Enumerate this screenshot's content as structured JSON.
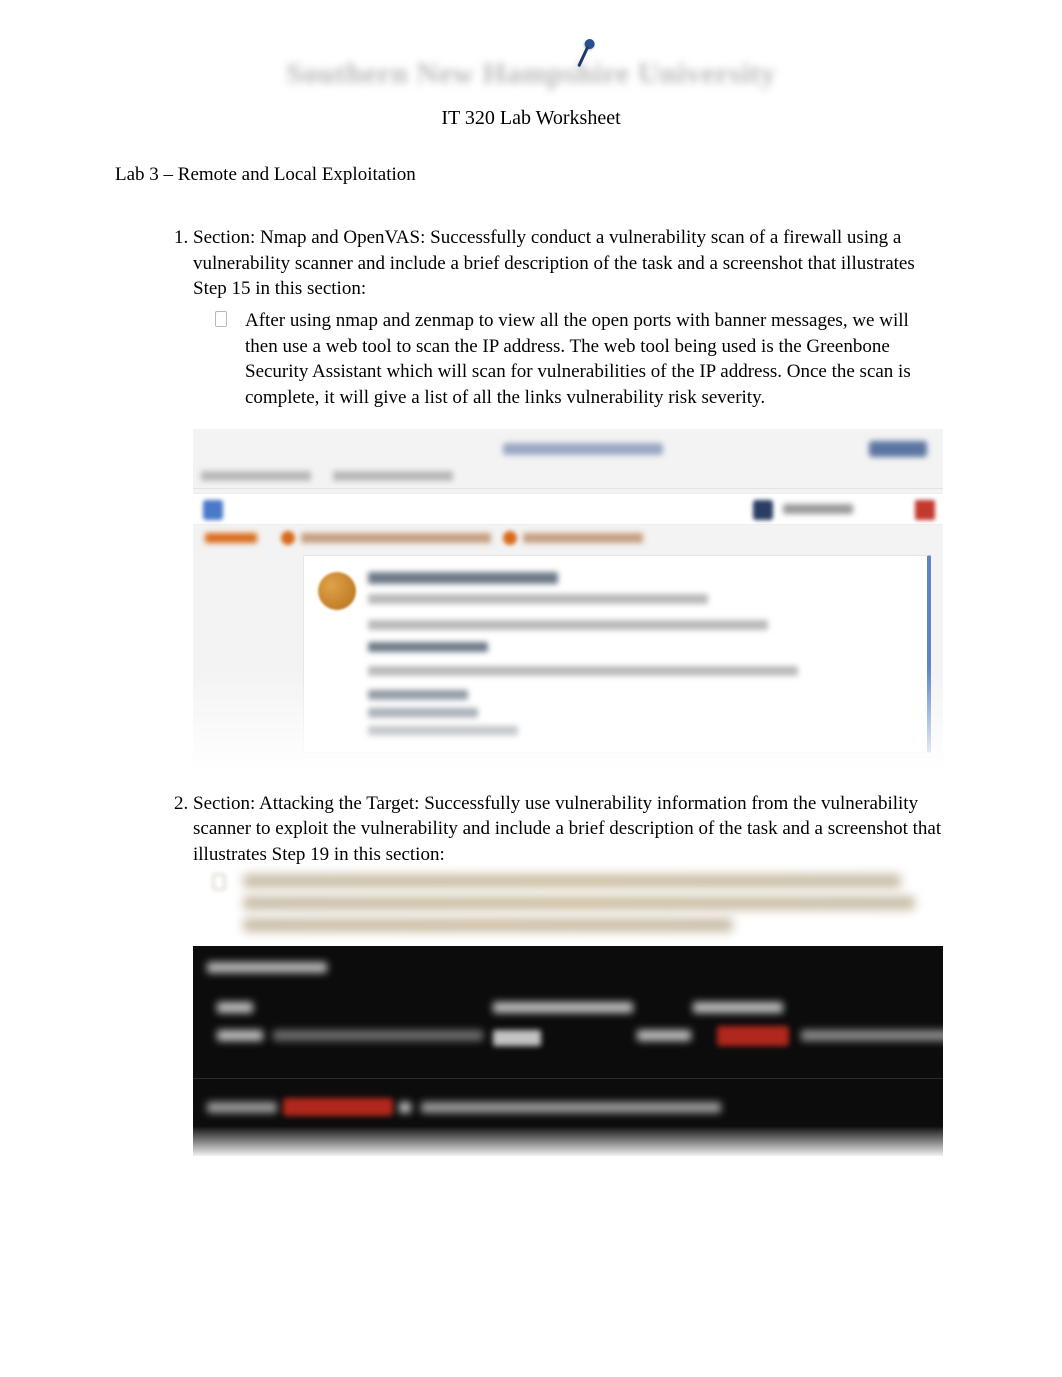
{
  "header": {
    "logo_text": "Southern New Hampshire University",
    "subtitle": "IT 320 Lab Worksheet"
  },
  "lab": {
    "title": "Lab 3 – Remote and Local Exploitation"
  },
  "questions": [
    {
      "number": "1",
      "prompt": "Section: Nmap and OpenVAS: Successfully conduct a vulnerability scan of a firewall using a vulnerability scanner and include a brief description of the task and a screenshot that illustrates Step 15 in this section:",
      "answer": "After using nmap and zenmap to view all the open ports with banner messages, we will then use a web tool to scan the IP address. The web tool being used is the Greenbone Security Assistant which will scan for vulnerabilities of the IP address. Once the scan is complete, it will give a list of all the links vulnerability risk severity."
    },
    {
      "number": "2",
      "prompt": "Section: Attacking the Target: Successfully use vulnerability information from the vulnerability scanner to exploit the vulnerability and include a brief description of the task and a screenshot that illustrates Step 19 in this section:"
    }
  ]
}
